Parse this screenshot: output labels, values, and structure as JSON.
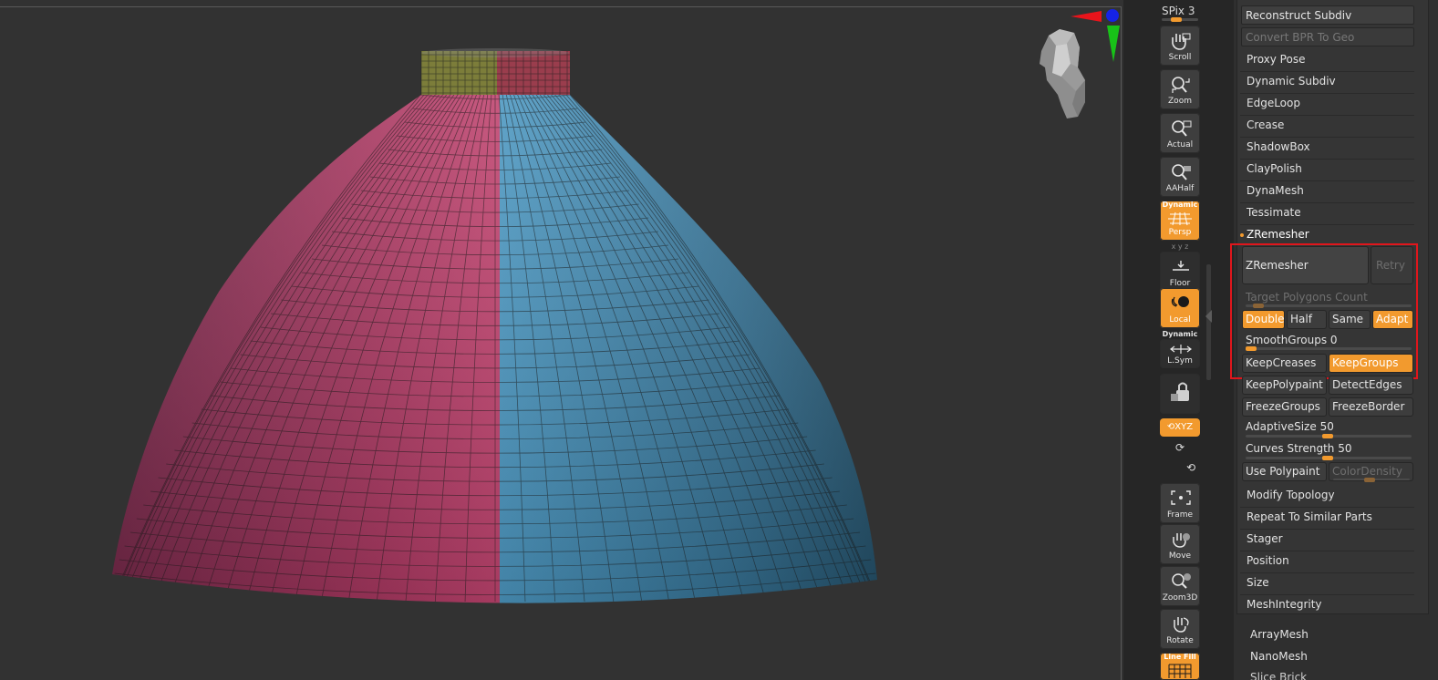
{
  "shelf": {
    "spix_label": "SPix 3",
    "spix_value": 3,
    "tools": [
      {
        "label": "Scroll",
        "icon": "hand-scroll-icon",
        "active": false
      },
      {
        "label": "Zoom",
        "icon": "magnifier-zoom-icon",
        "active": false
      },
      {
        "label": "Actual",
        "icon": "magnifier-actual-icon",
        "active": false
      },
      {
        "label": "AAHalf",
        "icon": "magnifier-aahalf-icon",
        "active": false
      },
      {
        "label": "Persp",
        "top_label": "Dynamic",
        "icon": "perspective-grid-icon",
        "active": true
      },
      {
        "label": "Floor",
        "icon": "floor-icon",
        "active": false
      },
      {
        "label": "Local",
        "icon": "local-pivot-icon",
        "active": true
      },
      {
        "label": "L.Sym",
        "top_label": "Dynamic",
        "icon": "local-symmetry-icon",
        "active": false
      },
      {
        "label": "",
        "icon": "lock-icon",
        "active": false
      },
      {
        "label": "XYZ",
        "icon": "xyz-rotate-icon",
        "active": true
      },
      {
        "label": "Frame",
        "icon": "frame-icon",
        "active": false
      },
      {
        "label": "Move",
        "icon": "hand-move-icon",
        "active": false
      },
      {
        "label": "Zoom3D",
        "icon": "zoom3d-icon",
        "active": false
      },
      {
        "label": "Rotate",
        "icon": "rotate-icon",
        "active": false
      },
      {
        "label": "",
        "top_label": "Line Fill",
        "icon": "line-fill-icon",
        "active": true
      }
    ]
  },
  "panel": {
    "reconstruct_subdiv": "Reconstruct Subdiv",
    "convert_bpr": "Convert BPR To Geo",
    "items": [
      "Proxy Pose",
      "Dynamic Subdiv",
      "EdgeLoop",
      "Crease",
      "ShadowBox",
      "ClayPolish",
      "DynaMesh",
      "Tessimate"
    ],
    "zremesher_header": "ZRemesher",
    "zremesher": {
      "button": "ZRemesher",
      "retry": "Retry",
      "target_polygons": "Target Polygons Count",
      "modes": [
        {
          "label": "Double",
          "on": true
        },
        {
          "label": "Half",
          "on": false
        },
        {
          "label": "Same",
          "on": false
        },
        {
          "label": "Adapt",
          "on": true
        }
      ],
      "smooth_groups_label": "SmoothGroups",
      "smooth_groups_value": "0",
      "keep_creases": "KeepCreases",
      "keep_groups": "KeepGroups",
      "keep_groups_on": true,
      "keep_polypaint": "KeepPolypaint",
      "detect_edges": "DetectEdges",
      "freeze_groups": "FreezeGroups",
      "freeze_border": "FreezeBorder",
      "adaptive_size_label": "AdaptiveSize",
      "adaptive_size_value": "50",
      "curves_strength_label": "Curves Strength",
      "curves_strength_value": "50",
      "use_polypaint": "Use Polypaint",
      "color_density": "ColorDensity"
    },
    "after_items": [
      "Modify Topology",
      "Repeat To Similar Parts",
      "Stager",
      "Position",
      "Size",
      "MeshIntegrity"
    ],
    "sub_items": [
      "ArrayMesh",
      "NanoMesh"
    ]
  },
  "colors": {
    "accent": "#f29a2e",
    "highlight_box": "#e0161c",
    "mesh_left": "#b23a66",
    "mesh_right": "#3f86ad",
    "neck_left": "#8a8a3e",
    "neck_right": "#9e3e4e"
  }
}
